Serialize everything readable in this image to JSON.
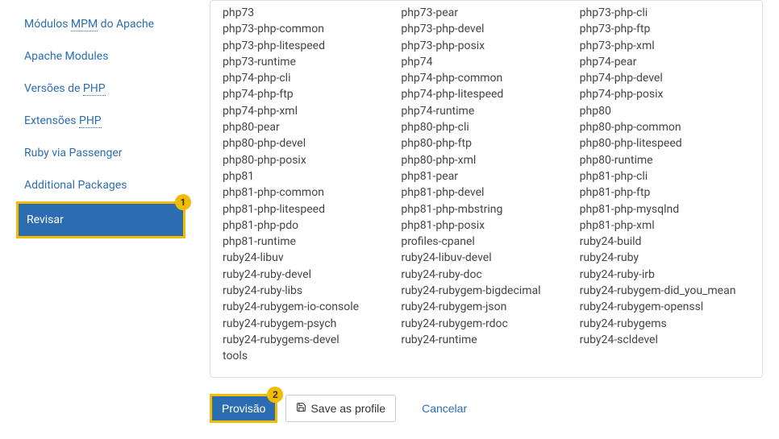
{
  "sidebar": {
    "items": [
      {
        "prefix": "Módulos ",
        "dotted": "MPM",
        "suffix": " do Apache"
      },
      {
        "prefix": "Apache Modules",
        "dotted": "",
        "suffix": ""
      },
      {
        "prefix": "Versões de ",
        "dotted": "PHP",
        "suffix": ""
      },
      {
        "prefix": "Extensões ",
        "dotted": "PHP",
        "suffix": ""
      },
      {
        "prefix": "Ruby via Passenger",
        "dotted": "",
        "suffix": ""
      },
      {
        "prefix": "Additional Packages",
        "dotted": "",
        "suffix": ""
      },
      {
        "prefix": "Revisar",
        "dotted": "",
        "suffix": ""
      }
    ],
    "active_index": 6,
    "badge1": "1"
  },
  "packages": [
    "php73",
    "php73-pear",
    "php73-php-cli",
    "php73-php-common",
    "php73-php-devel",
    "php73-php-ftp",
    "php73-php-litespeed",
    "php73-php-posix",
    "php73-php-xml",
    "php73-runtime",
    "php74",
    "php74-pear",
    "php74-php-cli",
    "php74-php-common",
    "php74-php-devel",
    "php74-php-ftp",
    "php74-php-litespeed",
    "php74-php-posix",
    "php74-php-xml",
    "php74-runtime",
    "php80",
    "php80-pear",
    "php80-php-cli",
    "php80-php-common",
    "php80-php-devel",
    "php80-php-ftp",
    "php80-php-litespeed",
    "php80-php-posix",
    "php80-php-xml",
    "php80-runtime",
    "php81",
    "php81-pear",
    "php81-php-cli",
    "php81-php-common",
    "php81-php-devel",
    "php81-php-ftp",
    "php81-php-litespeed",
    "php81-php-mbstring",
    "php81-php-mysqlnd",
    "php81-php-pdo",
    "php81-php-posix",
    "php81-php-xml",
    "php81-runtime",
    "profiles-cpanel",
    "ruby24-build",
    "ruby24-libuv",
    "ruby24-libuv-devel",
    "ruby24-ruby",
    "ruby24-ruby-devel",
    "ruby24-ruby-doc",
    "ruby24-ruby-irb",
    "ruby24-ruby-libs",
    "ruby24-rubygem-bigdecimal",
    "ruby24-rubygem-did_you_mean",
    "ruby24-rubygem-io-console",
    "ruby24-rubygem-json",
    "ruby24-rubygem-openssl",
    "ruby24-rubygem-psych",
    "ruby24-rubygem-rdoc",
    "ruby24-rubygems",
    "ruby24-rubygems-devel",
    "ruby24-runtime",
    "ruby24-scldevel",
    "tools"
  ],
  "actions": {
    "provision": "Provisão",
    "save_profile": "Save as profile",
    "cancel": "Cancelar",
    "badge2": "2"
  }
}
